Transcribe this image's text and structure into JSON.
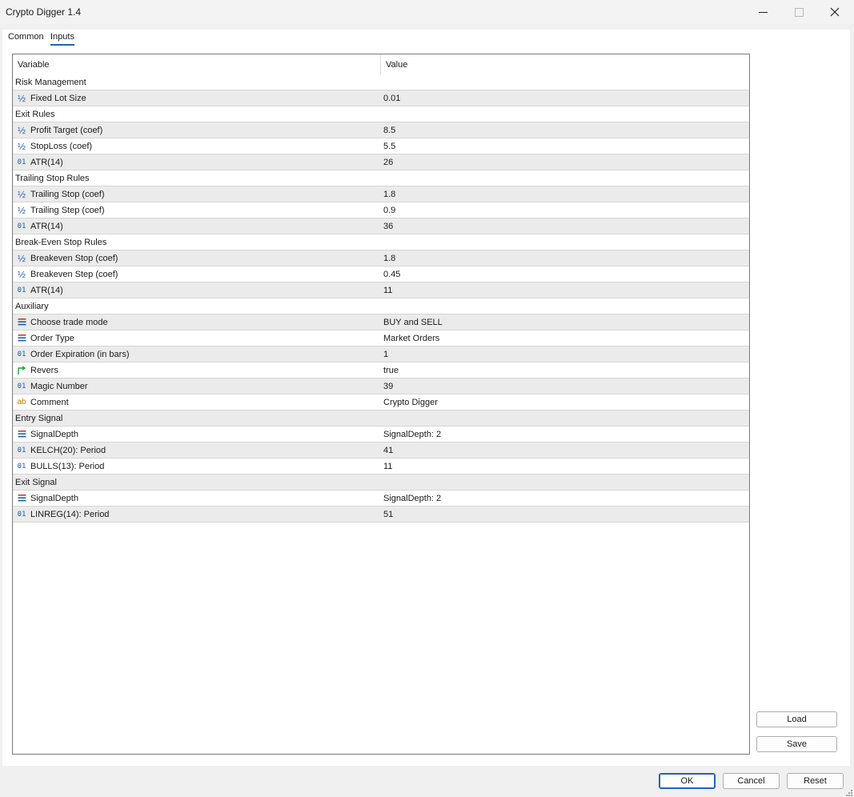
{
  "window": {
    "title": "Crypto Digger 1.4"
  },
  "tabs": [
    {
      "label": "Common",
      "active": false
    },
    {
      "label": "Inputs",
      "active": true
    }
  ],
  "table": {
    "headers": {
      "variable": "Variable",
      "value": "Value"
    },
    "rows": [
      {
        "type": "group",
        "name": "Risk Management",
        "value": ""
      },
      {
        "type": "param",
        "icon": "fraction-icon",
        "name": "Fixed Lot Size",
        "value": "0.01"
      },
      {
        "type": "group",
        "name": "Exit Rules",
        "value": ""
      },
      {
        "type": "param",
        "icon": "fraction-icon",
        "name": "Profit Target (coef)",
        "value": "8.5"
      },
      {
        "type": "param",
        "icon": "fraction-icon",
        "name": "StopLoss (coef)",
        "value": "5.5"
      },
      {
        "type": "param",
        "icon": "integer-icon",
        "name": "ATR(14)",
        "value": "26"
      },
      {
        "type": "group",
        "name": "Trailing Stop Rules",
        "value": ""
      },
      {
        "type": "param",
        "icon": "fraction-icon",
        "name": "Trailing Stop (coef)",
        "value": "1.8"
      },
      {
        "type": "param",
        "icon": "fraction-icon",
        "name": "Trailing Step (coef)",
        "value": "0.9"
      },
      {
        "type": "param",
        "icon": "integer-icon",
        "name": "ATR(14)",
        "value": "36"
      },
      {
        "type": "group",
        "name": "Break-Even Stop Rules",
        "value": ""
      },
      {
        "type": "param",
        "icon": "fraction-icon",
        "name": "Breakeven Stop (coef)",
        "value": "1.8"
      },
      {
        "type": "param",
        "icon": "fraction-icon",
        "name": "Breakeven Step (coef)",
        "value": "0.45"
      },
      {
        "type": "param",
        "icon": "integer-icon",
        "name": "ATR(14)",
        "value": "11"
      },
      {
        "type": "group",
        "name": "Auxiliary",
        "value": ""
      },
      {
        "type": "param",
        "icon": "enum-icon",
        "name": "Choose trade mode",
        "value": "BUY and SELL"
      },
      {
        "type": "param",
        "icon": "enum-icon",
        "name": "Order Type",
        "value": "Market Orders"
      },
      {
        "type": "param",
        "icon": "integer-icon",
        "name": "Order Expiration (in bars)",
        "value": "1"
      },
      {
        "type": "param",
        "icon": "boolean-icon",
        "name": "Revers",
        "value": "true"
      },
      {
        "type": "param",
        "icon": "integer-icon",
        "name": "Magic Number",
        "value": "39"
      },
      {
        "type": "param",
        "icon": "string-icon",
        "name": "Comment",
        "value": "Crypto Digger"
      },
      {
        "type": "group",
        "name": "Entry Signal",
        "value": ""
      },
      {
        "type": "param",
        "icon": "enum-icon",
        "name": "SignalDepth",
        "value": "SignalDepth: 2"
      },
      {
        "type": "param",
        "icon": "integer-icon",
        "name": "KELCH(20): Period",
        "value": "41"
      },
      {
        "type": "param",
        "icon": "integer-icon",
        "name": "BULLS(13): Period",
        "value": "11"
      },
      {
        "type": "group",
        "name": "Exit Signal",
        "value": ""
      },
      {
        "type": "param",
        "icon": "enum-icon",
        "name": "SignalDepth",
        "value": "SignalDepth: 2"
      },
      {
        "type": "param",
        "icon": "integer-icon",
        "name": "LINREG(14): Period",
        "value": "51"
      }
    ]
  },
  "side_buttons": {
    "load": "Load",
    "save": "Save"
  },
  "footer_buttons": {
    "ok": "OK",
    "cancel": "Cancel",
    "reset": "Reset"
  },
  "colors": {
    "accent": "#1f64b4",
    "row_alt": "#ebebeb",
    "icon_number": "#1f5fa8",
    "icon_string": "#c08000",
    "icon_bool": "#1ea23a"
  }
}
